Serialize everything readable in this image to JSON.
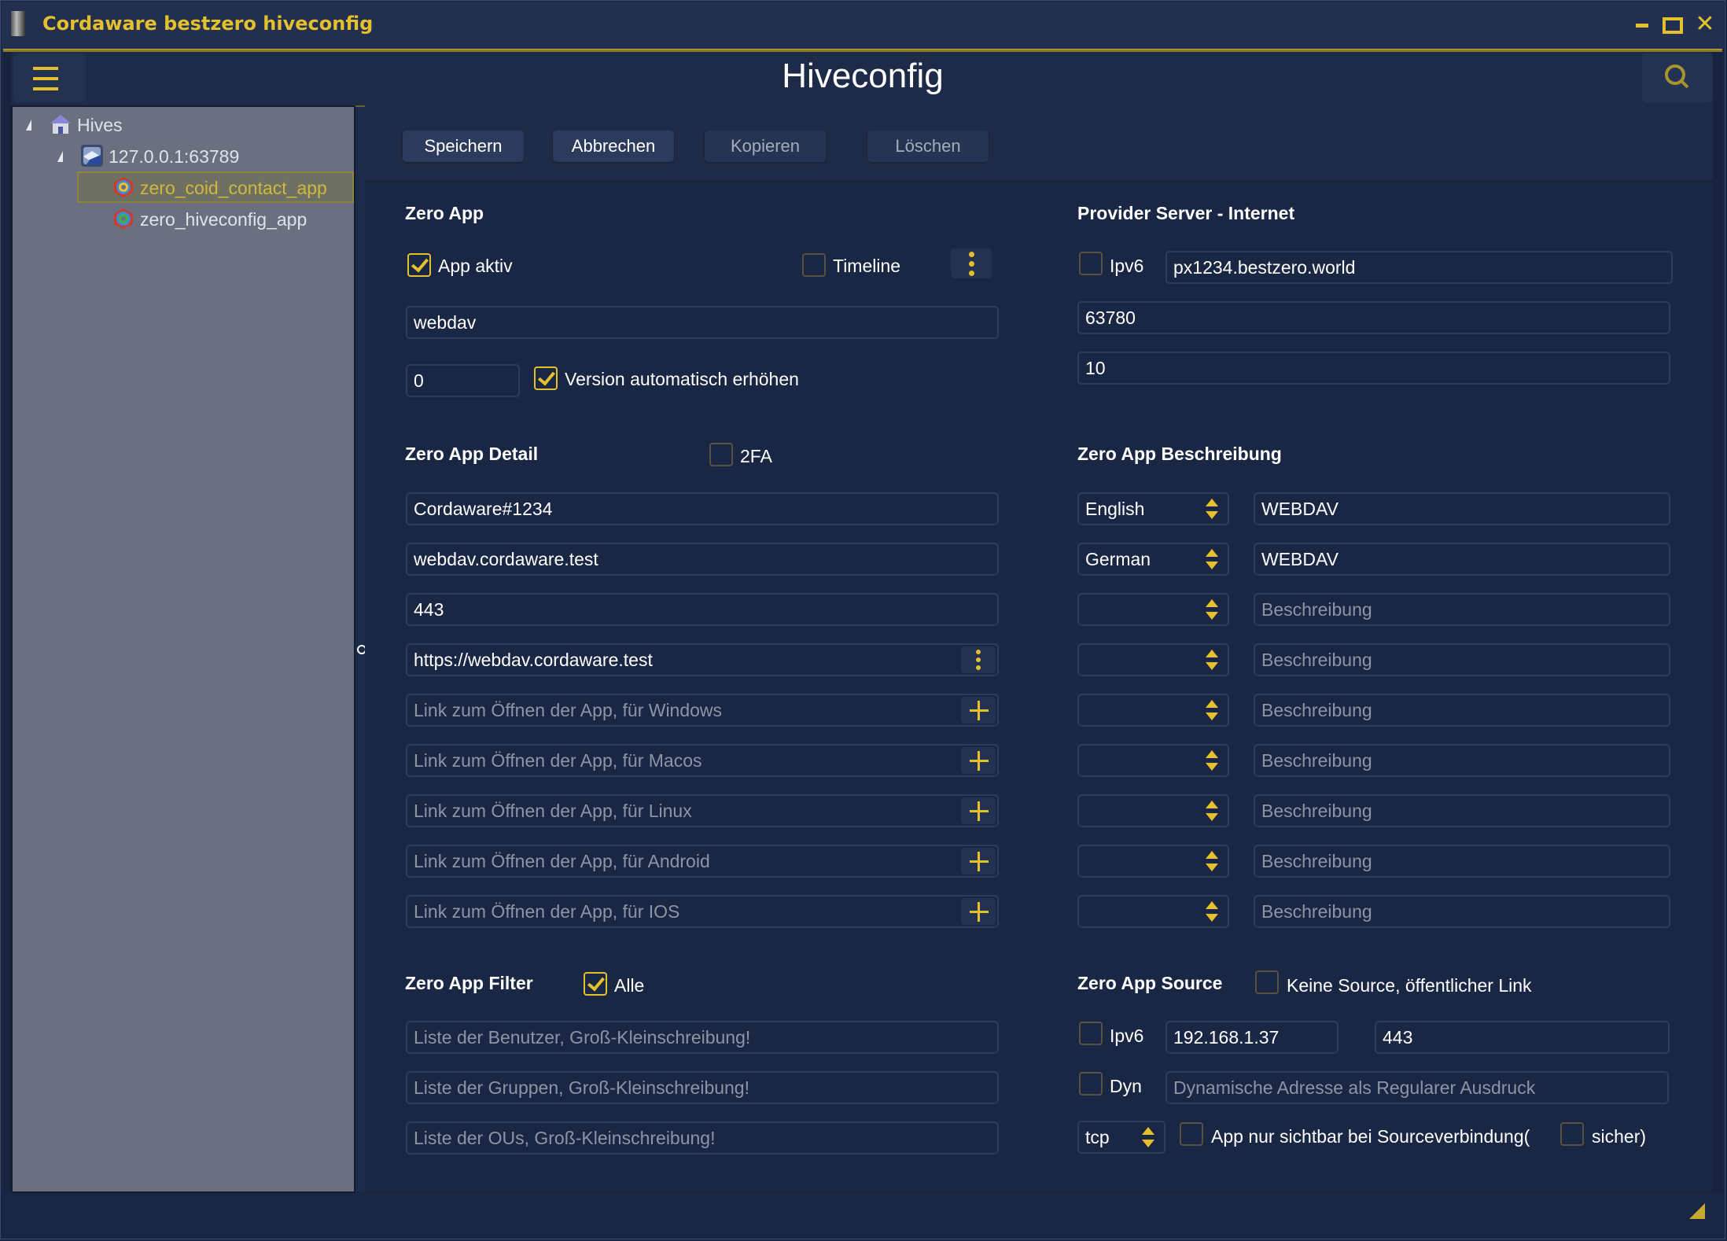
{
  "window": {
    "title": "Cordaware bestzero hiveconfig",
    "controls": {
      "minimize": "minimize",
      "maximize": "maximize",
      "close": "✕"
    }
  },
  "header": {
    "page_title": "Hiveconfig",
    "menu_icon": "hamburger-menu-icon",
    "search_icon": "search-icon"
  },
  "tree": {
    "root": "Hives",
    "server": "127.0.0.1:63789",
    "apps": [
      {
        "label": "zero_coid_contact_app",
        "selected": true
      },
      {
        "label": "zero_hiveconfig_app",
        "selected": false
      }
    ]
  },
  "toolbar": {
    "save": "Speichern",
    "cancel": "Abbrechen",
    "copy": "Kopieren",
    "delete": "Löschen"
  },
  "zero_app": {
    "title": "Zero App",
    "app_active_label": "App aktiv",
    "app_active_checked": true,
    "timeline_label": "Timeline",
    "timeline_checked": false,
    "name": "webdav",
    "version": "0",
    "auto_version_label": "Version automatisch erhöhen",
    "auto_version_checked": true
  },
  "provider_server": {
    "title": "Provider Server - Internet",
    "ipv6_label": "Ipv6",
    "ipv6_checked": false,
    "host": "px1234.bestzero.world",
    "port": "63780",
    "value3": "10"
  },
  "zero_app_detail": {
    "title": "Zero App Detail",
    "twofa_label": "2FA",
    "twofa_checked": false,
    "field1": "Cordaware#1234",
    "field2": "webdav.cordaware.test",
    "field3": "443",
    "url": "https://webdav.cordaware.test",
    "links": [
      {
        "placeholder": "Link zum Öffnen der App, für Windows"
      },
      {
        "placeholder": "Link zum Öffnen der App, für Macos"
      },
      {
        "placeholder": "Link zum Öffnen der App, für Linux"
      },
      {
        "placeholder": "Link zum Öffnen der App, für Android"
      },
      {
        "placeholder": "Link zum Öffnen der App, für IOS"
      }
    ]
  },
  "description": {
    "title": "Zero App Beschreibung",
    "rows": [
      {
        "language": "English",
        "text": "WEBDAV",
        "placeholder": "Beschreibung"
      },
      {
        "language": "German",
        "text": "WEBDAV",
        "placeholder": "Beschreibung"
      },
      {
        "language": "",
        "text": "",
        "placeholder": "Beschreibung"
      },
      {
        "language": "",
        "text": "",
        "placeholder": "Beschreibung"
      },
      {
        "language": "",
        "text": "",
        "placeholder": "Beschreibung"
      },
      {
        "language": "",
        "text": "",
        "placeholder": "Beschreibung"
      },
      {
        "language": "",
        "text": "",
        "placeholder": "Beschreibung"
      },
      {
        "language": "",
        "text": "",
        "placeholder": "Beschreibung"
      },
      {
        "language": "",
        "text": "",
        "placeholder": "Beschreibung"
      }
    ]
  },
  "filter": {
    "title": "Zero App Filter",
    "all_label": "Alle",
    "all_checked": true,
    "users_placeholder": "Liste der Benutzer, Groß-Kleinschreibung!",
    "groups_placeholder": "Liste der Gruppen, Groß-Kleinschreibung!",
    "ous_placeholder": "Liste der OUs, Groß-Kleinschreibung!"
  },
  "source": {
    "title": "Zero App Source",
    "no_source_label": "Keine Source, öffentlicher Link",
    "no_source_checked": false,
    "ipv6_label": "Ipv6",
    "ipv6_checked": false,
    "address": "192.168.1.37",
    "port": "443",
    "dyn_label": "Dyn",
    "dyn_checked": false,
    "dyn_placeholder": "Dynamische Adresse als Regularer Ausdruck",
    "protocol": "tcp",
    "visible_only_label": "App nur sichtbar bei Sourceverbindung(",
    "visible_only_checked": false,
    "secure_label": "sicher)",
    "secure_checked": false
  },
  "colors": {
    "accent": "#e5c02e",
    "background": "#1a2744",
    "tree_bg": "#6a707f"
  }
}
